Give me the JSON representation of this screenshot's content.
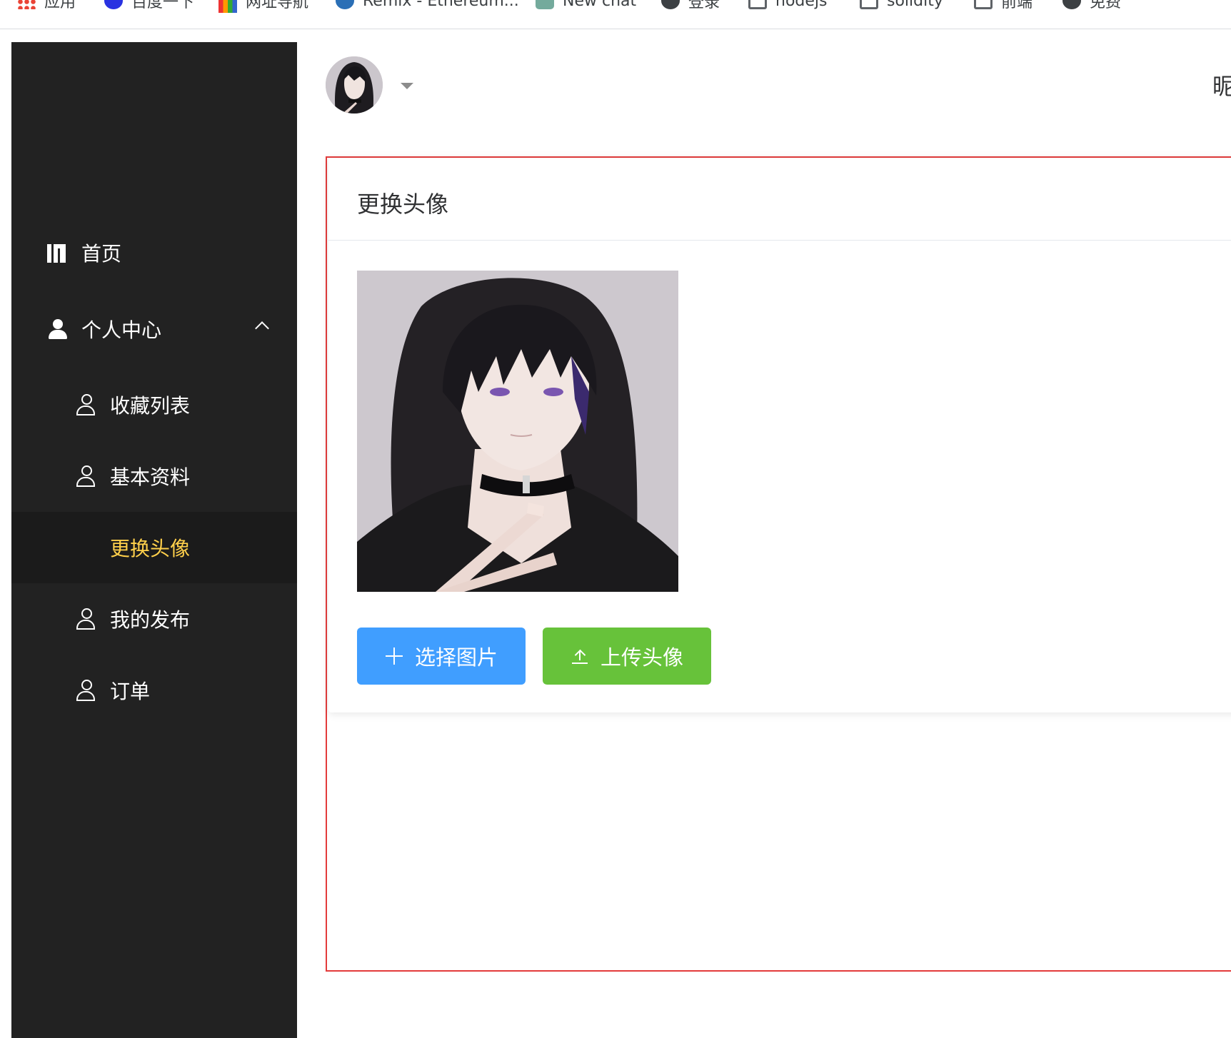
{
  "bookmarks": [
    {
      "label": "应用",
      "icon": "apps-icon"
    },
    {
      "label": "百度一下",
      "icon": "baidu-icon"
    },
    {
      "label": "网址导航",
      "icon": "2345-icon"
    },
    {
      "label": "Remix - Ethereum...",
      "icon": "remix-icon"
    },
    {
      "label": "New chat",
      "icon": "chatgpt-icon"
    },
    {
      "label": "登录",
      "icon": "globe-icon"
    },
    {
      "label": "nodejs",
      "icon": "folder-icon"
    },
    {
      "label": "solidity",
      "icon": "folder-icon"
    },
    {
      "label": "前端",
      "icon": "folder-icon"
    },
    {
      "label": "免费",
      "icon": "globe-icon"
    }
  ],
  "sidebar": {
    "home": {
      "label": "首页",
      "icon": "book-icon"
    },
    "personal": {
      "label": "个人中心",
      "icon": "user-icon",
      "expanded": true
    },
    "items": [
      {
        "label": "收藏列表",
        "icon": "user-outline-icon"
      },
      {
        "label": "基本资料",
        "icon": "user-outline-icon"
      },
      {
        "label": "更换头像",
        "active": true
      },
      {
        "label": "我的发布",
        "icon": "user-outline-icon"
      },
      {
        "label": "订单",
        "icon": "user-outline-icon"
      }
    ],
    "active_color": "#ffd04b",
    "background": "#222222"
  },
  "header": {
    "nickname_prefix": "昵"
  },
  "card": {
    "title": "更换头像",
    "select_button": "选择图片",
    "upload_button": "上传头像",
    "select_color": "#409eff",
    "upload_color": "#67c23a"
  }
}
